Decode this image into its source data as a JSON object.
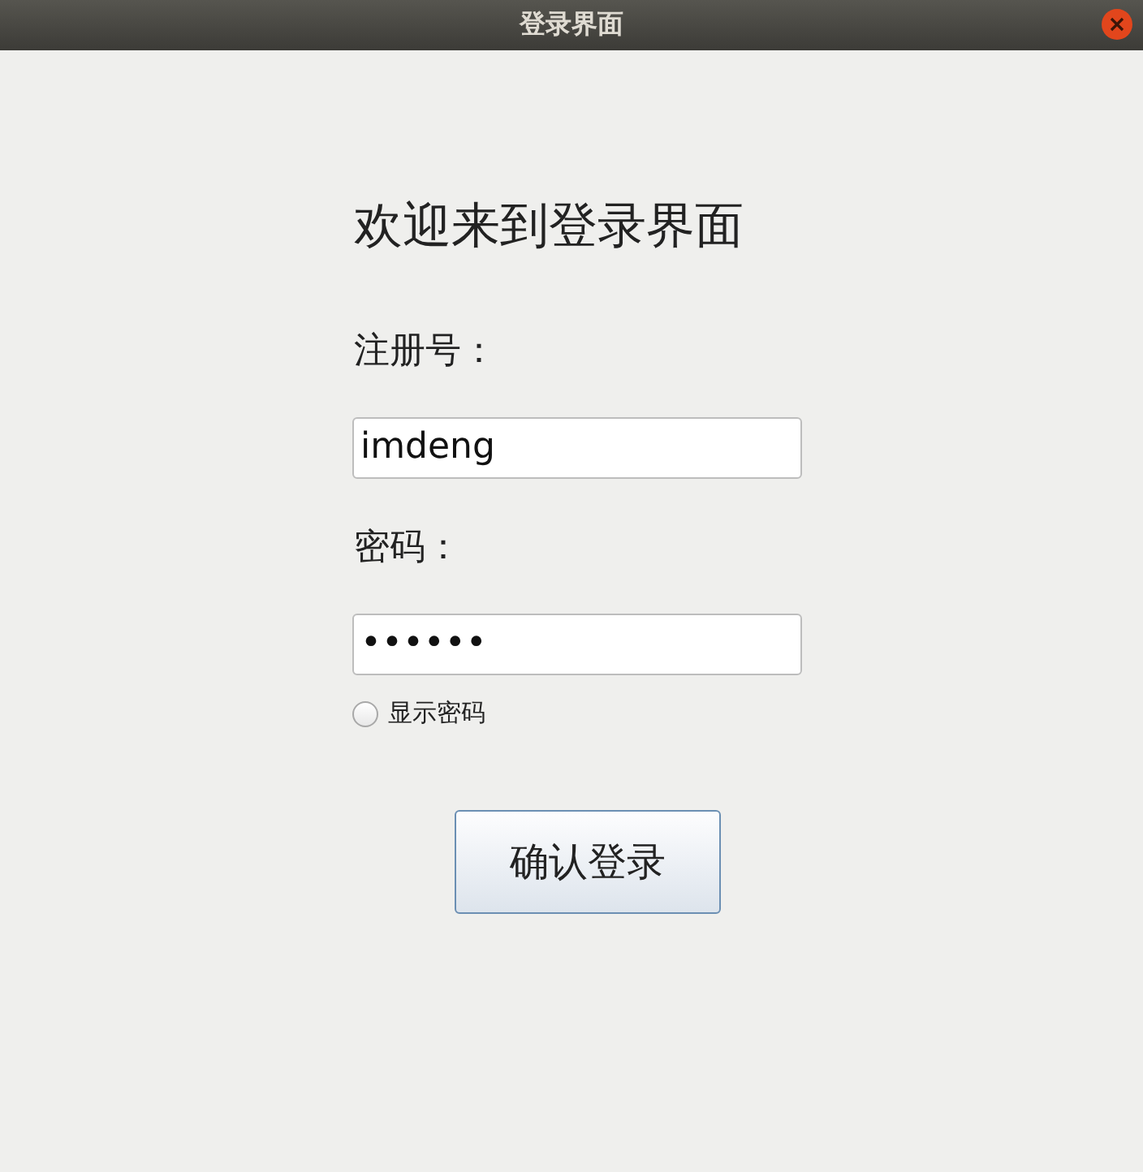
{
  "window": {
    "title": "登录界面"
  },
  "heading": "欢迎来到登录界面",
  "fields": [
    {
      "label": "注册号：",
      "value": "imdeng"
    },
    {
      "label": "密码：",
      "value": "••••••"
    }
  ],
  "show_password": {
    "label": "显示密码",
    "checked": false
  },
  "login_button": "确认登录"
}
